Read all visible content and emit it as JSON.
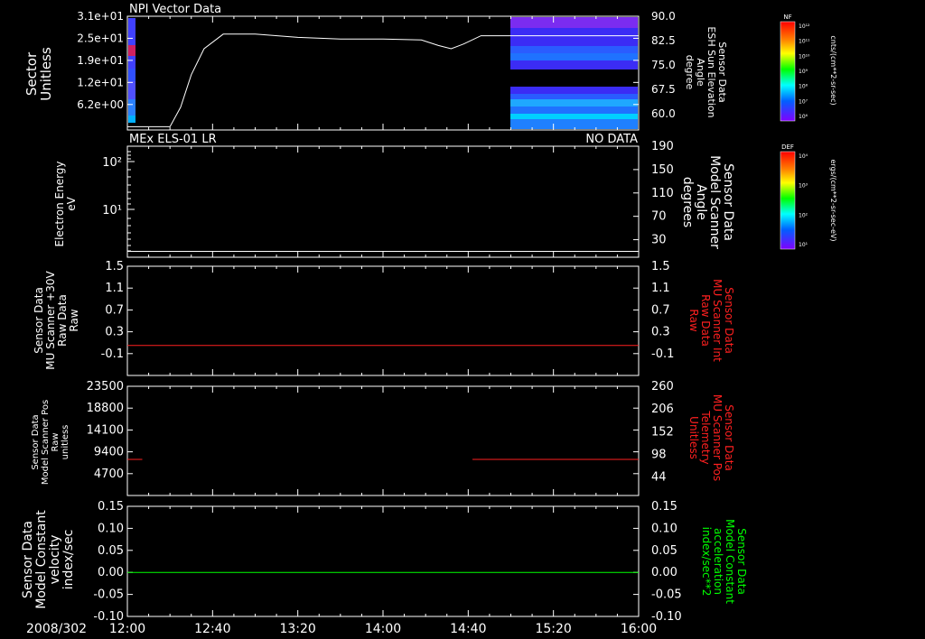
{
  "colors": {
    "background": "#000000",
    "axes": "#ffffff",
    "red": "#ff2020",
    "green": "#00ff00"
  },
  "time_axis": {
    "start_label": "2008/302",
    "ticks": [
      "12:00",
      "12:40",
      "13:20",
      "14:00",
      "14:40",
      "15:20",
      "16:00"
    ],
    "minutes": [
      0,
      40,
      80,
      120,
      160,
      200,
      240
    ],
    "range_minutes": [
      0,
      240
    ]
  },
  "colorbars": [
    {
      "title": "NF",
      "unit": "cnts/(cm**2-sr-sec)",
      "ticks": [
        "10¹²",
        "10¹¹",
        "10¹⁰",
        "10⁹",
        "10⁸",
        "10⁷",
        "10⁶"
      ]
    },
    {
      "title": "DEF",
      "unit": "ergs/(cm**2-sr-sec-eV)",
      "ticks": [
        "10⁴",
        "10³",
        "10²",
        "10¹"
      ]
    }
  ],
  "chart_data": [
    {
      "type": "heatmap",
      "title": "NPI Vector Data",
      "ylabel": [
        "Sector",
        "Unitless"
      ],
      "yticks": [
        "3.1e+01",
        "2.5e+01",
        "1.9e+01",
        "1.2e+01",
        "6.2e+00"
      ],
      "ylim": [
        0,
        31
      ],
      "y2label": [
        "Sensor Data",
        "ESH Sun Elevation",
        "Angle",
        "degree"
      ],
      "y2ticks": [
        "90.0",
        "82.5",
        "75.0",
        "67.5",
        "60.0"
      ],
      "y2tick_values": [
        90,
        82.5,
        75,
        67.5,
        60
      ],
      "y2lim": [
        55,
        90
      ],
      "heatmap_blocks_minutes": [
        [
          0,
          5
        ],
        [
          166,
          240
        ]
      ],
      "line_series": {
        "name": "ESH Sun Elevation",
        "x_minutes": [
          0,
          10,
          20,
          25,
          30,
          36,
          45,
          60,
          80,
          100,
          120,
          138,
          146,
          152,
          158,
          166,
          180,
          240
        ],
        "y": [
          56,
          56,
          56,
          62,
          72,
          80,
          84.5,
          84.5,
          83.5,
          83,
          83,
          82.7,
          81,
          80,
          81.5,
          84,
          84,
          84
        ]
      }
    },
    {
      "type": "line",
      "title": "MEx ELS-01 LR",
      "status": "NO DATA",
      "ylabel": [
        "Electron Energy",
        "eV"
      ],
      "yticks": [
        "10²",
        "10¹"
      ],
      "y2label": [
        "Sensor Data",
        "Model Scanner",
        "Angle",
        "degrees"
      ],
      "y2ticks": [
        "190",
        "150",
        "110",
        "70",
        "30"
      ],
      "y2tick_values": [
        190,
        150,
        110,
        70,
        30
      ],
      "y2lim": [
        0,
        190
      ],
      "series": [
        {
          "name": "Model Scanner Angle",
          "x_minutes": [
            0,
            240
          ],
          "y": [
            10,
            10
          ]
        }
      ]
    },
    {
      "type": "line",
      "ylabel": [
        "Sensor Data",
        "MU Scanner +30V",
        "Raw Data",
        "Raw"
      ],
      "yticks": [
        "1.5",
        "1.1",
        "0.7",
        "0.3",
        "-0.1"
      ],
      "ytick_values": [
        1.5,
        1.1,
        0.7,
        0.3,
        -0.1
      ],
      "ylim": [
        -0.5,
        1.5
      ],
      "y2label": [
        "Sensor Data",
        "MU Scanner Int",
        "Raw Data",
        "Raw"
      ],
      "y2ticks": [
        "1.5",
        "1.1",
        "0.7",
        "0.3",
        "-0.1"
      ],
      "series": [
        {
          "name": "MU Scanner Int Raw Data",
          "x_minutes": [
            0,
            240
          ],
          "y": [
            0.05,
            0.05
          ]
        }
      ]
    },
    {
      "type": "line",
      "ylabel": [
        "Sensor Data",
        "Model Scanner Pos",
        "Raw",
        "unitless"
      ],
      "yticks": [
        "23500",
        "18800",
        "14100",
        "9400",
        "4700"
      ],
      "ytick_values": [
        23500,
        18800,
        14100,
        9400,
        4700
      ],
      "ylim": [
        0,
        23500
      ],
      "y2label": [
        "Sensor Data",
        "MU Scanner Pos",
        "Telemetry",
        "Unitless"
      ],
      "y2ticks": [
        "260",
        "206",
        "152",
        "98",
        "44"
      ],
      "y2tick_values": [
        260,
        206,
        152,
        98,
        44
      ],
      "y2lim": [
        0,
        260
      ],
      "series": [
        {
          "name": "MU Scanner Pos Telemetry",
          "x_minutes": [
            0,
            7
          ],
          "y": [
            86,
            86
          ]
        },
        {
          "name": "MU Scanner Pos Telemetry",
          "x_minutes": [
            162,
            240
          ],
          "y": [
            86,
            86
          ]
        }
      ]
    },
    {
      "type": "line",
      "ylabel": [
        "Sensor Data",
        "Model Constant",
        "velocity",
        "index/sec"
      ],
      "yticks": [
        "0.15",
        "0.10",
        "0.05",
        "0.00",
        "-0.05",
        "-0.10"
      ],
      "ytick_values": [
        0.15,
        0.1,
        0.05,
        0.0,
        -0.05,
        -0.1
      ],
      "ylim": [
        -0.1,
        0.15
      ],
      "y2label": [
        "Sensor Data",
        "Model Constant",
        "acceleration",
        "index/sec**2"
      ],
      "y2ticks": [
        "0.15",
        "0.10",
        "0.05",
        "0.00",
        "-0.05",
        "-0.10"
      ],
      "series": [
        {
          "name": "Model Constant acceleration",
          "x_minutes": [
            0,
            240
          ],
          "y": [
            0,
            0
          ]
        }
      ]
    }
  ]
}
